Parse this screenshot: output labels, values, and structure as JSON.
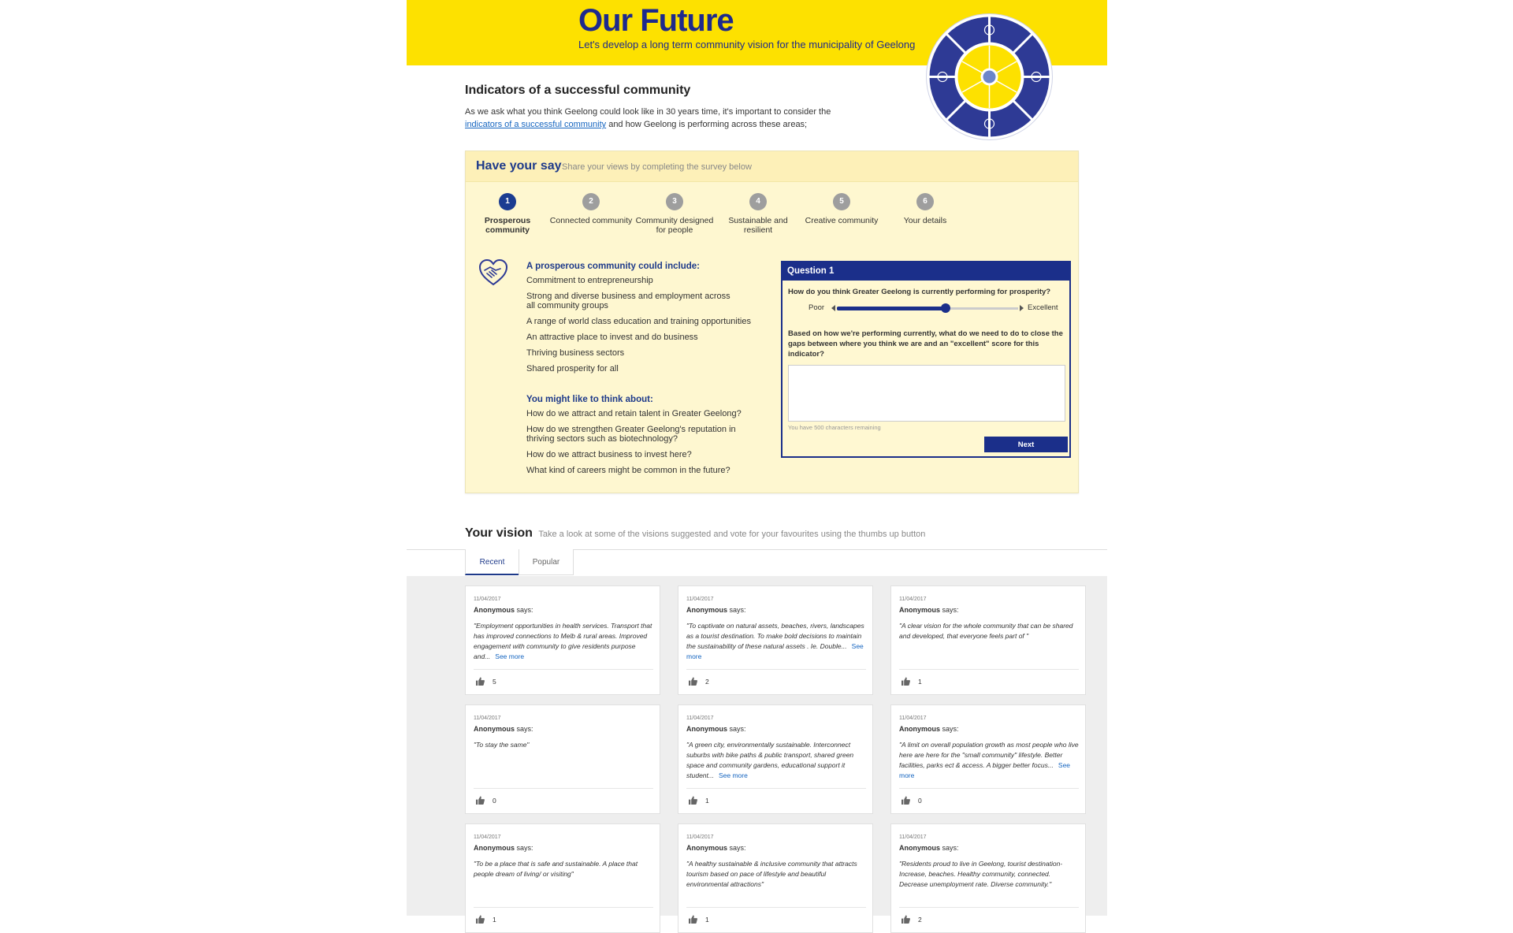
{
  "header": {
    "title": "Our Future",
    "subtitle": "Let's develop a long term community vision for the municipality of Geelong"
  },
  "intro": {
    "title": "Indicators of a successful community",
    "text_before": "As we ask what you think Geelong could look like in 30 years time, it's important to consider the",
    "link": "indicators of a successful community",
    "text_after": " and how Geelong is performing across these areas;"
  },
  "survey": {
    "title": "Have your say",
    "subtitle": "Share your views by completing the survey below",
    "steps": [
      {
        "num": "1",
        "label": "Prosperous community"
      },
      {
        "num": "2",
        "label": "Connected community"
      },
      {
        "num": "3",
        "label": "Community designed for people"
      },
      {
        "num": "4",
        "label": "Sustainable and resilient"
      },
      {
        "num": "5",
        "label": "Creative community"
      },
      {
        "num": "6",
        "label": "Your details"
      }
    ],
    "include_heading": "A prosperous community could include:",
    "include_items": [
      "Commitment to entrepreneurship",
      "Strong and diverse business and employment across all community groups",
      "A range of world class education and training opportunities",
      "An attractive place to invest and do business",
      "Thriving business sectors",
      "Shared prosperity for all"
    ],
    "think_heading": "You might like to think about:",
    "think_items": [
      "How do we attract and retain talent in Greater Geelong?",
      "How do we strengthen Greater Geelong's reputation in thriving sectors such as biotechnology?",
      "How do we attract business to invest here?",
      "What kind of careers might be common in the future?"
    ],
    "question": {
      "title": "Question 1",
      "prompt": "How do you think Greater Geelong is currently performing for prosperity?",
      "poor_label": "Poor",
      "excellent_label": "Excellent",
      "slider_fraction": 0.6,
      "followup": "Based on how we're performing currently, what do we need to do to close the gaps between where you think we are and an \"excellent\" score for this indicator?",
      "remaining": "You have 500 characters remaining",
      "next_label": "Next"
    }
  },
  "vision": {
    "title": "Your vision",
    "subtitle": "Take a look at some of the visions suggested and vote for your favourites using the thumbs up button",
    "tabs": [
      "Recent",
      "Popular"
    ],
    "says": "says:",
    "see_more": "See more",
    "cards": [
      {
        "date": "11/04/2017",
        "author": "Anonymous",
        "text": "\"Employment opportunities in health services. Transport that has improved connections to Melb & rural areas. Improved engagement with community to give residents purpose and...",
        "more": true,
        "likes": "5"
      },
      {
        "date": "11/04/2017",
        "author": "Anonymous",
        "text": "\"To captivate on natural assets, beaches, rivers, landscapes as a tourist destination. To make bold decisions to maintain the sustainability of these natural assets . Ie. Double...",
        "more": true,
        "likes": "2"
      },
      {
        "date": "11/04/2017",
        "author": "Anonymous",
        "text": "\"A clear vision for the whole community that can be shared and developed, that everyone feels part of \"",
        "more": false,
        "likes": "1"
      },
      {
        "date": "11/04/2017",
        "author": "Anonymous",
        "text": "\"To stay the same\"",
        "more": false,
        "likes": "0"
      },
      {
        "date": "11/04/2017",
        "author": "Anonymous",
        "text": "\"A green city, environmentally sustainable. Interconnect suburbs with bike paths & public transport, shared green space and community gardens, educational support it student...",
        "more": true,
        "likes": "1"
      },
      {
        "date": "11/04/2017",
        "author": "Anonymous",
        "text": "\"A limit on overall population growth as most people who live here are here for the \"small community\" lifestyle. Better facilities, parks ect & access. A bigger better focus...",
        "more": true,
        "likes": "0"
      },
      {
        "date": "11/04/2017",
        "author": "Anonymous",
        "text": "\"To be a place that is safe and sustainable. A place that people dream of living/ or visiting\"",
        "more": false,
        "likes": "1"
      },
      {
        "date": "11/04/2017",
        "author": "Anonymous",
        "text": "\"A healthy sustainable & inclusive community that attracts tourism based on pace of lifestyle and beautiful environmental attractions\"",
        "more": false,
        "likes": "1"
      },
      {
        "date": "11/04/2017",
        "author": "Anonymous",
        "text": "\"Residents proud to live in Geelong, tourist destination- Increase, beaches. Healthy community, connected. Decrease unemployment rate. Diverse community.\"",
        "more": false,
        "likes": "2"
      }
    ]
  },
  "colors": {
    "brand_yellow": "#fde100",
    "brand_navy": "#1e2a8c",
    "panel_bg": "#fef7d0",
    "link_blue": "#1565c0"
  }
}
